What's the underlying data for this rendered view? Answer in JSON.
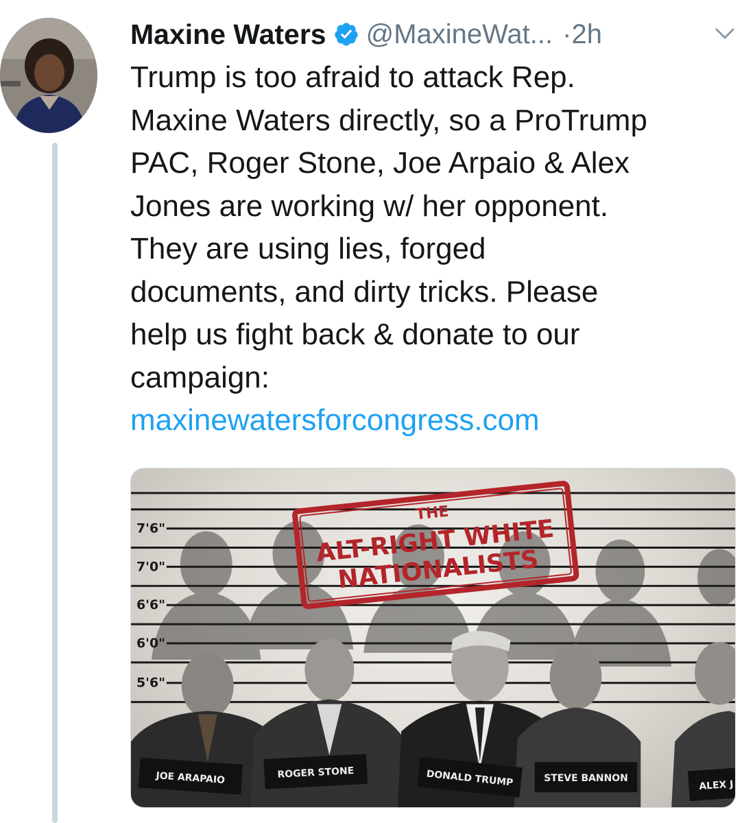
{
  "tweet": {
    "author_name": "Maxine Waters",
    "handle": "@MaxineWat...",
    "separator": "·",
    "time": "2h",
    "text_lines": [
      "Trump is too afraid to attack Rep.",
      "Maxine Waters directly, so a ProTrump",
      "PAC, Roger Stone, Joe Arpaio & Alex",
      "Jones are working w/ her opponent.",
      "They are using lies, forged",
      "documents, and dirty tricks. Please",
      "help us fight back & donate to our",
      "campaign:"
    ],
    "link": "maxinewatersforcongress.com"
  },
  "media": {
    "stamp_top": "THE",
    "stamp_line1": "ALT-RIGHT WHITE",
    "stamp_line2": "NATIONALISTS",
    "height_marks": [
      "7'6\"",
      "7'0\"",
      "6'6\"",
      "6'0\"",
      "5'6\""
    ],
    "name_plates": [
      "JOE ARAPAIO",
      "ROGER STONE",
      "DONALD TRUMP",
      "STEVE BANNON",
      "ALEX J"
    ]
  },
  "icons": {
    "verified": "verified-badge-icon",
    "menu": "chevron-down-icon"
  },
  "colors": {
    "link": "#1da1f2",
    "verified": "#1da1f2",
    "secondary_text": "#657786",
    "stamp_red": "#b3252a"
  }
}
